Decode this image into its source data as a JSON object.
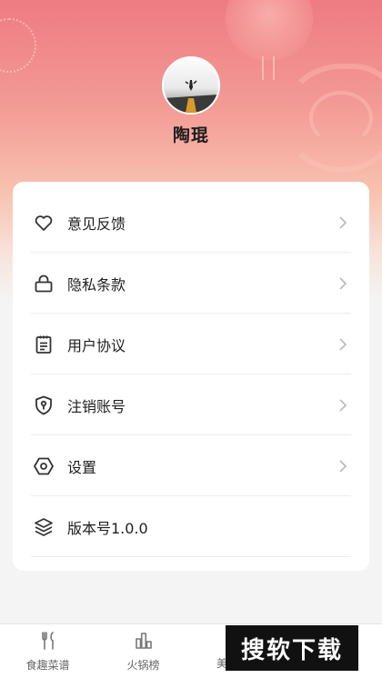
{
  "profile": {
    "username": "陶琨"
  },
  "menu": {
    "items": [
      {
        "label": "意见反馈",
        "icon": "heart-icon",
        "has_arrow": true
      },
      {
        "label": "隐私条款",
        "icon": "lock-icon",
        "has_arrow": true
      },
      {
        "label": "用户协议",
        "icon": "clipboard-icon",
        "has_arrow": true
      },
      {
        "label": "注销账号",
        "icon": "shield-key-icon",
        "has_arrow": true
      },
      {
        "label": "设置",
        "icon": "hexagon-settings-icon",
        "has_arrow": true
      },
      {
        "label": "版本号1.0.0",
        "icon": "layers-icon",
        "has_arrow": false
      }
    ]
  },
  "tabbar": {
    "tabs": [
      {
        "label": "食趣菜谱",
        "icon": "utensils-icon"
      },
      {
        "label": "火锅榜",
        "icon": "bar-chart-icon"
      },
      {
        "label": "美",
        "icon": ""
      }
    ]
  },
  "watermark": {
    "text": "搜软下载"
  },
  "colors": {
    "header_top": "#ee7b82",
    "header_bottom": "#f4f4f4",
    "card": "#ffffff",
    "icon_stroke": "#333333",
    "chevron": "#bdbdbd"
  }
}
